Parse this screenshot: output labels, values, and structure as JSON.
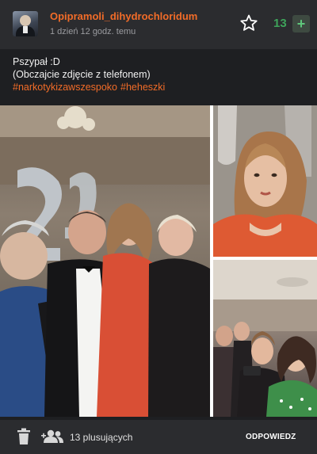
{
  "post": {
    "author": "Opipramoli_dihydrochloridum",
    "timestamp": "1 dzień 12 godz. temu",
    "votes": "13",
    "upvote_symbol": "+",
    "body_line1": "Pszypał :D",
    "body_line2": "(Obczajcie zdjęcie z telefonem)",
    "tags": [
      "#narkotykizawszespoko",
      "#heheszki"
    ]
  },
  "footer": {
    "plusers": "13 plusujących",
    "reply_label": "ODPOWIEDZ"
  },
  "icons": {
    "favorite": "star-outline-icon",
    "delete": "trash-icon",
    "plusers": "people-icon"
  },
  "colors": {
    "accent": "#f26c28",
    "vote_green": "#3ea35a",
    "background": "#1e1f22",
    "panel": "#2b2c2f"
  }
}
